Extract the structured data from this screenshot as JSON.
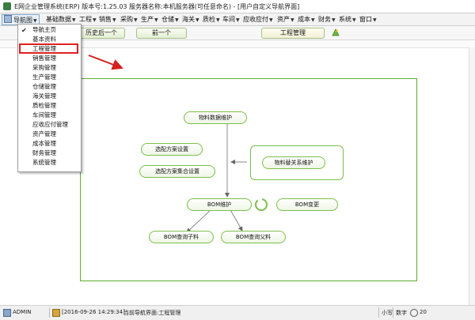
{
  "window": {
    "title": "E网企业管理系统(ERP)  版本号:1.25.03  服务器名称:本机服务器(可任意命名)  - [用户自定义导航界面]"
  },
  "menubar": {
    "items": [
      "导航图",
      "基础数据",
      "工程",
      "销售",
      "采购",
      "生产",
      "仓储",
      "海关",
      "质检",
      "车间",
      "应收应付",
      "资产",
      "成本",
      "财务",
      "系统",
      "窗口"
    ]
  },
  "toolbar": {
    "history_back": "历史后一个",
    "prev": "前一个",
    "current_tab": "工程管理"
  },
  "dropdown": {
    "items": [
      "导航主页",
      "基本资料",
      "工程管理",
      "销售管理",
      "采购管理",
      "生产管理",
      "仓储管理",
      "海关管理",
      "质检管理",
      "车间管理",
      "应收应付管理",
      "资产管理",
      "成本管理",
      "财务管理",
      "系统管理"
    ],
    "checked_item": "导航主页",
    "highlighted_item": "工程管理"
  },
  "diagram": {
    "nodes": {
      "material_maintenance": "物料数据维护",
      "option_settings": "选配方案设置",
      "option_set_settings": "选配方案集合设置",
      "material_relation": "物料替关系维护",
      "bom_maintenance": "BOM维护",
      "bom_change": "BOM变更",
      "bom_query_child": "BOM查询子料",
      "bom_query_parent": "BOM查询父料"
    }
  },
  "statusbar": {
    "user": "ADMIN",
    "datetime": "[2016-09-26 14:29:34]",
    "message": "当前导航界面:工程管理",
    "caps": "小写",
    "numlock": "数字",
    "clock_partial": "20"
  },
  "colors": {
    "accent_green": "#5fad2f",
    "highlight_red": "#e02020",
    "arrow_red": "#d42020"
  }
}
